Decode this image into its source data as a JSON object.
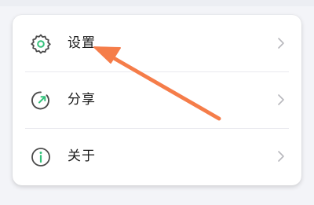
{
  "menu": {
    "items": [
      {
        "label": "设置",
        "icon": "gear-icon"
      },
      {
        "label": "分享",
        "icon": "share-icon"
      },
      {
        "label": "关于",
        "icon": "info-icon"
      }
    ]
  },
  "colors": {
    "accent_green": "#34c17b",
    "icon_gray": "#4a4a4a",
    "annotation_arrow": "#f57d4a"
  }
}
